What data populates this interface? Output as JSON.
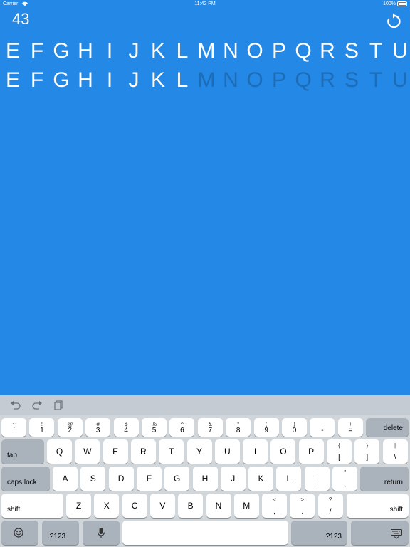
{
  "status": {
    "carrier": "Carrier",
    "time": "11:42 PM",
    "battery": "100%"
  },
  "game": {
    "score": "43",
    "target_letters": [
      "E",
      "F",
      "G",
      "H",
      "I",
      "J",
      "K",
      "L",
      "M",
      "N",
      "O",
      "P",
      "Q",
      "R",
      "S",
      "T",
      "U"
    ],
    "typed_letters": [
      "E",
      "F",
      "G",
      "H",
      "I",
      "J",
      "K",
      "L",
      "M",
      "N",
      "O",
      "P",
      "Q",
      "R",
      "S",
      "T",
      "U"
    ],
    "typed_count": 8
  },
  "keyboard": {
    "shortcuts": [
      "undo-icon",
      "redo-icon",
      "paste-icon"
    ],
    "row1": [
      {
        "top": "~",
        "bot": "`"
      },
      {
        "top": "!",
        "bot": "1"
      },
      {
        "top": "@",
        "bot": "2"
      },
      {
        "top": "#",
        "bot": "3"
      },
      {
        "top": "$",
        "bot": "4"
      },
      {
        "top": "%",
        "bot": "5"
      },
      {
        "top": "^",
        "bot": "6"
      },
      {
        "top": "&",
        "bot": "7"
      },
      {
        "top": "*",
        "bot": "8"
      },
      {
        "top": "(",
        "bot": "9"
      },
      {
        "top": ")",
        "bot": "0"
      },
      {
        "top": "_",
        "bot": "-"
      },
      {
        "top": "+",
        "bot": "="
      }
    ],
    "delete": "delete",
    "tab": "tab",
    "row2": [
      "Q",
      "W",
      "E",
      "R",
      "T",
      "Y",
      "U",
      "I",
      "O",
      "P"
    ],
    "row2_sym": [
      {
        "top": "{",
        "bot": "["
      },
      {
        "top": "}",
        "bot": "]"
      },
      {
        "top": "|",
        "bot": "\\"
      }
    ],
    "caps": "caps lock",
    "row3": [
      "A",
      "S",
      "D",
      "F",
      "G",
      "H",
      "J",
      "K",
      "L"
    ],
    "row3_sym": [
      {
        "top": ":",
        "bot": ";"
      },
      {
        "top": "\"",
        "bot": ","
      }
    ],
    "return": "return",
    "shift": "shift",
    "row4": [
      "Z",
      "X",
      "C",
      "V",
      "B",
      "N",
      "M"
    ],
    "row4_sym": [
      {
        "top": "<",
        "bot": ","
      },
      {
        "top": ">",
        "bot": "."
      },
      {
        "top": "?",
        "bot": "/"
      }
    ],
    "num_label": ".?123"
  }
}
